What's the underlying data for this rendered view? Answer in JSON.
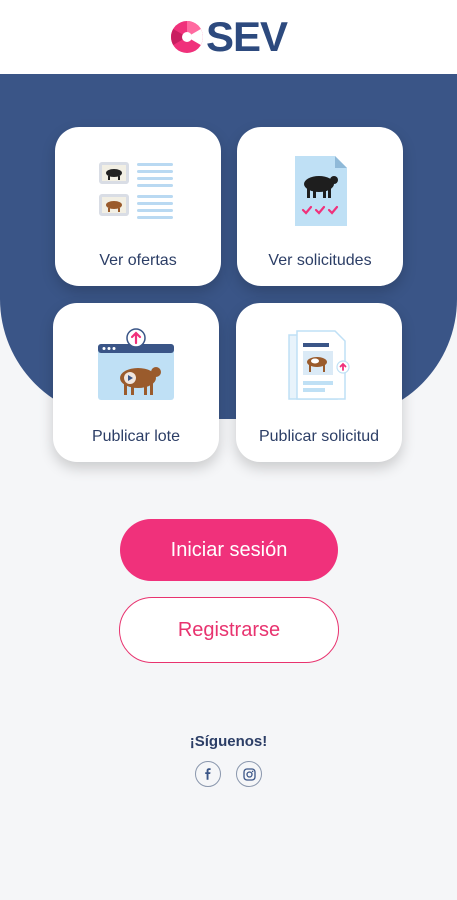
{
  "brand": {
    "name": "SEV",
    "primary_color": "#2d4a7e",
    "accent_color": "#f0317b"
  },
  "cards": [
    {
      "label": "Ver ofertas",
      "icon": "offers-list-icon"
    },
    {
      "label": "Ver solicitudes",
      "icon": "requests-document-icon"
    },
    {
      "label": "Publicar lote",
      "icon": "publish-lot-video-icon"
    },
    {
      "label": "Publicar solicitud",
      "icon": "publish-request-document-icon"
    }
  ],
  "actions": {
    "login_label": "Iniciar sesión",
    "register_label": "Registrarse"
  },
  "social": {
    "title": "¡Síguenos!",
    "icons": [
      "facebook-icon",
      "instagram-icon"
    ]
  }
}
